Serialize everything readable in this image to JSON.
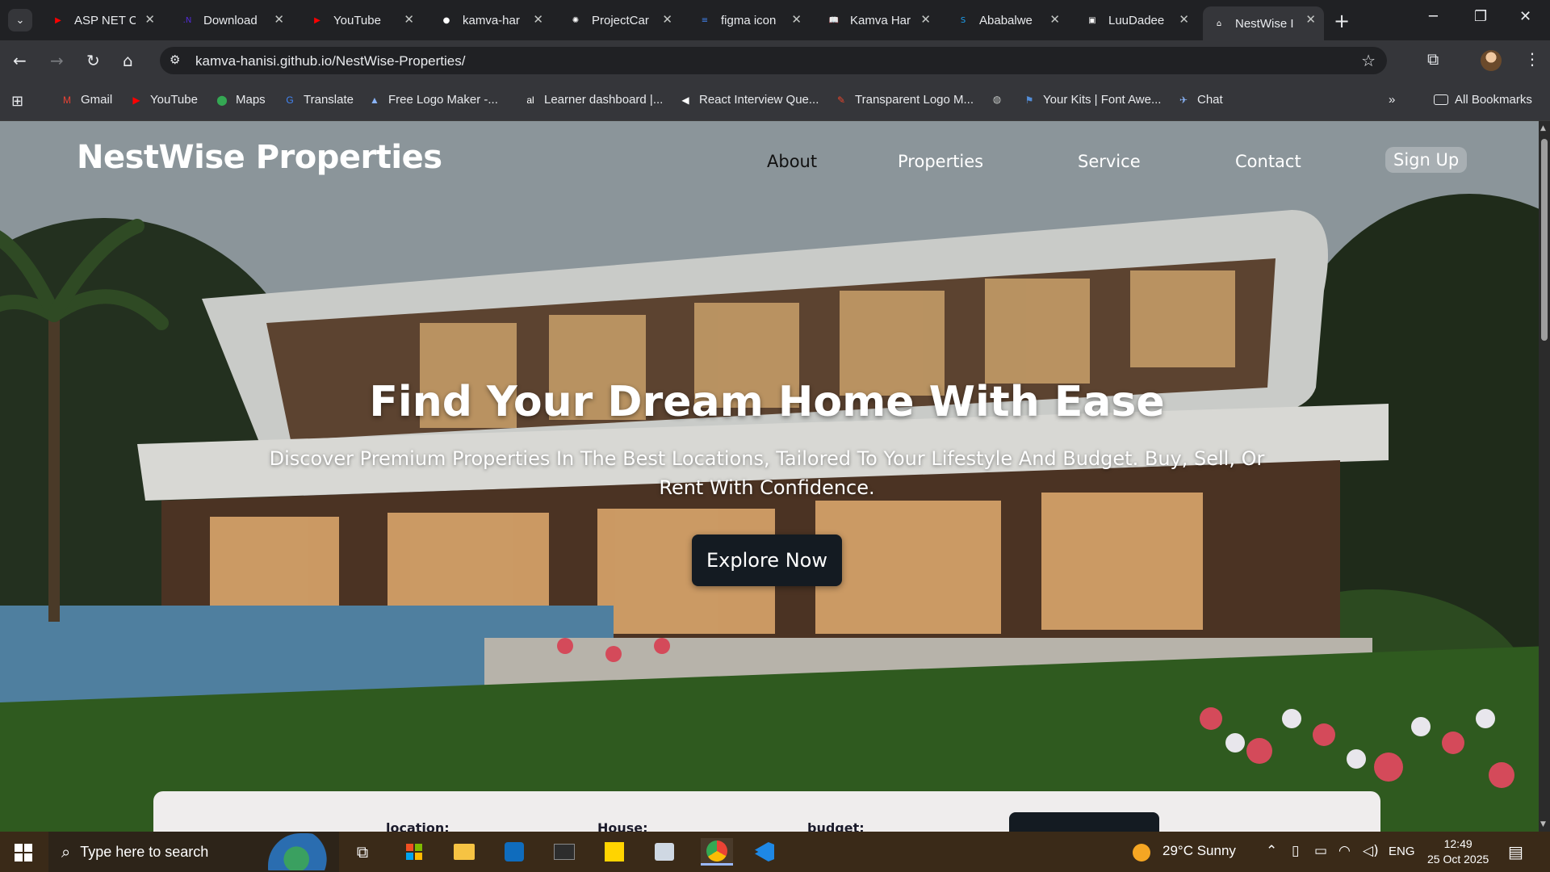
{
  "browser": {
    "tabs": [
      {
        "title": "ASP NET C",
        "icon": "youtube-icon",
        "color": "#ff0000"
      },
      {
        "title": "Download",
        "icon": "dotnet-icon",
        "color": "#512bd4"
      },
      {
        "title": "YouTube",
        "icon": "youtube-icon",
        "color": "#ff0000"
      },
      {
        "title": "kamva-har",
        "icon": "github-icon",
        "color": "#ffffff"
      },
      {
        "title": "ProjectCar",
        "icon": "chatgpt-icon",
        "color": "#ffffff"
      },
      {
        "title": "figma icon",
        "icon": "docs-icon",
        "color": "#4285f4"
      },
      {
        "title": "Kamva Har",
        "icon": "book-icon",
        "color": "#8ab4f8"
      },
      {
        "title": "Ababalwe",
        "icon": "s-icon",
        "color": "#1da1f2"
      },
      {
        "title": "LuuDadee",
        "icon": "image-icon",
        "color": "#ffffff"
      },
      {
        "title": "NestWise I",
        "icon": "house-icon",
        "color": "#ffffff"
      }
    ],
    "url": "kamva-hanisi.github.io/NestWise-Properties/",
    "bookmarks": [
      {
        "label": "Gmail",
        "icon": "gmail-icon",
        "color": "#ea4335"
      },
      {
        "label": "YouTube",
        "icon": "youtube-icon",
        "color": "#ff0000"
      },
      {
        "label": "Maps",
        "icon": "maps-icon",
        "color": "#34a853"
      },
      {
        "label": "Translate",
        "icon": "translate-icon",
        "color": "#4285f4"
      },
      {
        "label": "Free Logo Maker -...",
        "icon": "logo-maker-icon",
        "color": "#8ab4f8"
      },
      {
        "label": "Learner dashboard |...",
        "icon": "alx-icon",
        "color": "#ffffff"
      },
      {
        "label": "React Interview Que...",
        "icon": "react-icon",
        "color": "#ffffff"
      },
      {
        "label": "Transparent Logo M...",
        "icon": "logo-m-icon",
        "color": "#e8452c"
      },
      {
        "label": "",
        "icon": "globe-icon",
        "color": "#c4c7c5"
      },
      {
        "label": "Your Kits | Font Awe...",
        "icon": "fontawesome-icon",
        "color": "#538dd7"
      },
      {
        "label": "Chat",
        "icon": "chat-icon",
        "color": "#8ab4f8"
      }
    ],
    "all_bookmarks": "All Bookmarks"
  },
  "site": {
    "logo": "NestWise Properties",
    "nav": [
      "About",
      "Properties",
      "Service",
      "Contact"
    ],
    "signup": "Sign Up",
    "hero_title": "Find Your Dream Home With Ease",
    "hero_subtitle": "Discover Premium Properties In The Best Locations, Tailored To Your Lifestyle And Budget. Buy, Sell, Or Rent With Confidence.",
    "cta": "Explore Now",
    "search_fields": [
      "location:",
      "House:",
      "budget:"
    ]
  },
  "taskbar": {
    "search_placeholder": "Type here to search",
    "weather": "29°C  Sunny",
    "lang": "ENG",
    "time": "12:49",
    "date": "25 Oct 2025"
  }
}
